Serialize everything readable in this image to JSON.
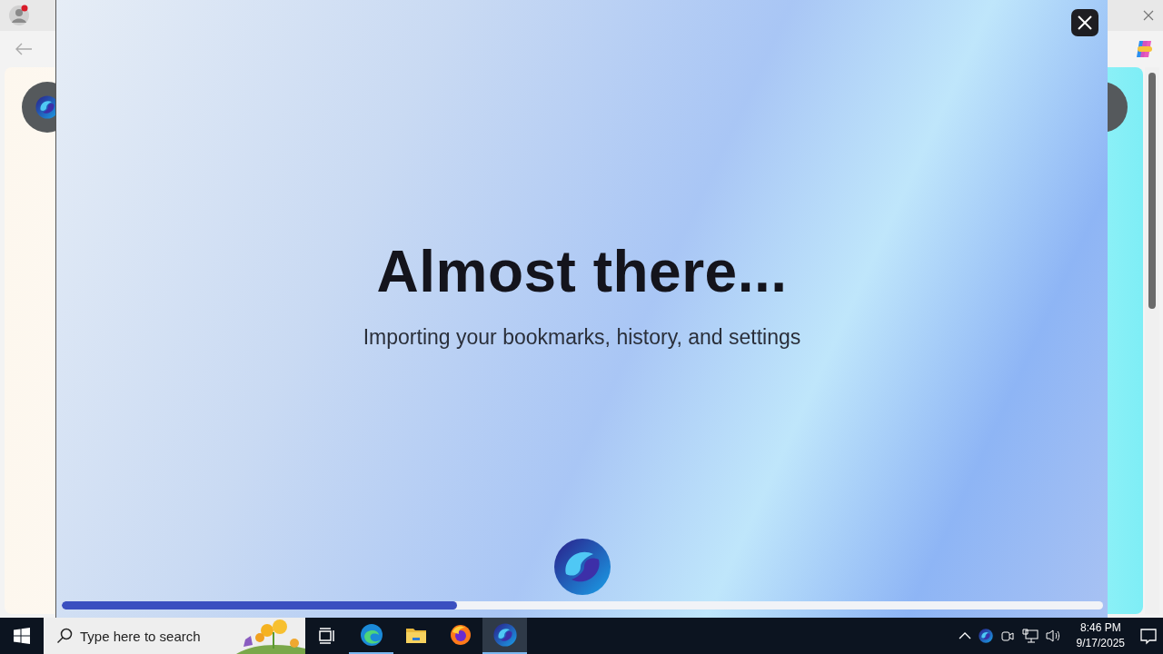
{
  "dialog": {
    "title": "Almost there...",
    "subtitle": "Importing your bookmarks, history, and settings",
    "progress": {
      "level": 0.38
    }
  },
  "taskbar": {
    "search": {
      "placeholder": "Type here to search"
    },
    "apps": [
      {
        "kind": "edge",
        "running": true,
        "selected": false
      },
      {
        "kind": "folder",
        "running": false,
        "selected": false
      },
      {
        "kind": "firefox",
        "running": false,
        "selected": false
      },
      {
        "kind": "sphere",
        "running": true,
        "selected": true
      }
    ],
    "clock": {
      "time": "8:46 PM",
      "date": "9/17/2025"
    }
  }
}
